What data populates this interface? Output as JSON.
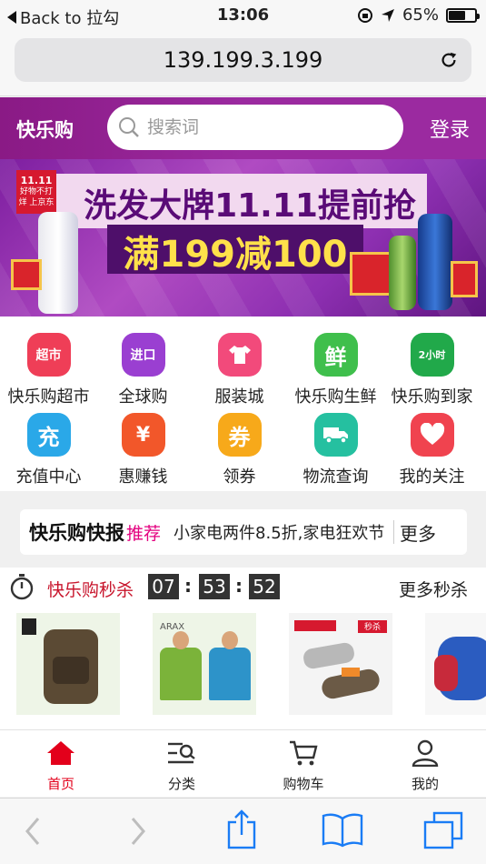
{
  "status_bar": {
    "back_label": "Back to 拉勾",
    "time": "13:06",
    "battery": "65%",
    "battery_level": 0.65
  },
  "browser": {
    "url": "139.199.3.199"
  },
  "header": {
    "logo": "快乐购",
    "search_placeholder": "搜索词",
    "login": "登录"
  },
  "banner": {
    "headline": "洗发大牌11.11提前抢",
    "promo": "满199减100",
    "badge_top": "11.11",
    "badge_bottom": "好物不打烊 上京东"
  },
  "categories": [
    {
      "label": "快乐购超市",
      "icon": "supermarket-icon",
      "icon_text": "超市",
      "color": "#ef3e57"
    },
    {
      "label": "全球购",
      "icon": "global-import-icon",
      "icon_text": "进口",
      "color": "#9a3fd1"
    },
    {
      "label": "服装城",
      "icon": "clothing-icon",
      "icon_text": "",
      "color": "#f24a7b"
    },
    {
      "label": "快乐购生鲜",
      "icon": "fresh-icon",
      "icon_text": "鲜",
      "color": "#3fbf4c"
    },
    {
      "label": "快乐购到家",
      "icon": "delivery-icon",
      "icon_text": "2小时",
      "color": "#21a94a"
    },
    {
      "label": "充值中心",
      "icon": "recharge-icon",
      "icon_text": "充",
      "color": "#2aa8e8"
    },
    {
      "label": "惠赚钱",
      "icon": "money-bag-icon",
      "icon_text": "¥",
      "color": "#f2572a"
    },
    {
      "label": "领券",
      "icon": "coupon-icon",
      "icon_text": "券",
      "color": "#f7a91a"
    },
    {
      "label": "物流查询",
      "icon": "truck-icon",
      "icon_text": "",
      "color": "#25c0a0"
    },
    {
      "label": "我的关注",
      "icon": "heart-icon",
      "icon_text": "",
      "color": "#f0434f"
    }
  ],
  "news": {
    "title": "快乐购快报",
    "tag": "推荐",
    "text": "小家电两件8.5折,家电狂欢节",
    "more": "更多"
  },
  "flash_sale": {
    "title": "快乐购秒杀",
    "hours": "07",
    "minutes": "53",
    "seconds": "52",
    "more": "更多秒杀",
    "product_brand_labels": [
      "ARAX",
      "秒杀"
    ]
  },
  "tab_bar": {
    "items": [
      {
        "label": "首页"
      },
      {
        "label": "分类"
      },
      {
        "label": "购物车"
      },
      {
        "label": "我的"
      }
    ]
  }
}
